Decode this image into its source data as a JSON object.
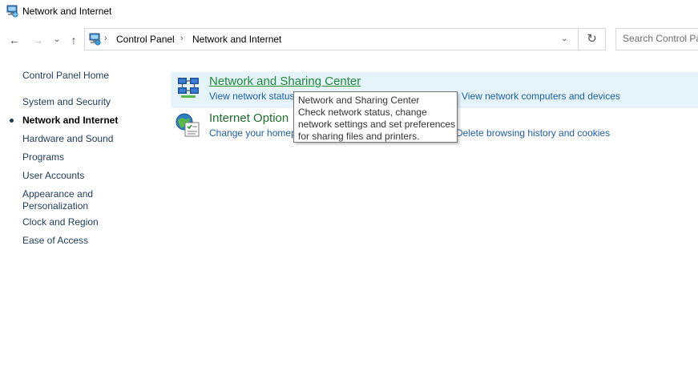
{
  "window": {
    "title": "Network and Internet",
    "icon": "network-internet-icon"
  },
  "nav": {
    "back_glyph": "←",
    "forward_glyph": "→",
    "recent_glyph": "⌄",
    "up_glyph": "↑",
    "refresh_glyph": "↻"
  },
  "address": {
    "sep": "›",
    "crumbs": [
      "Control Panel",
      "Network and Internet"
    ],
    "dropdown_glyph": "⌄"
  },
  "search": {
    "placeholder": "Search Control Pa"
  },
  "sidebar": {
    "home": "Control Panel Home",
    "items": [
      {
        "label": "System and Security"
      },
      {
        "label": "Network and Internet",
        "selected": true
      },
      {
        "label": "Hardware and Sound"
      },
      {
        "label": "Programs"
      },
      {
        "label": "User Accounts"
      },
      {
        "label": "Appearance and",
        "label2": "Personalization"
      },
      {
        "label": "Clock and Region"
      },
      {
        "label": "Ease of Access"
      }
    ]
  },
  "categories": [
    {
      "title": "Network and Sharing Center",
      "links": [
        "View network status",
        "View network computers and devices"
      ]
    },
    {
      "title": "Internet Option",
      "links": [
        "Change your homep",
        "Delete browsing history and cookies"
      ]
    }
  ],
  "tooltip": {
    "lines": [
      "Network and Sharing Center",
      "Check network status, change",
      "network settings and set preferences",
      "for sharing files and printers."
    ]
  },
  "colors": {
    "link_blue": "#1c5ea8",
    "title_green": "#1f8a3a",
    "hover_bg": "#e5f3fb",
    "sidebar_text": "#1e3b5a"
  }
}
